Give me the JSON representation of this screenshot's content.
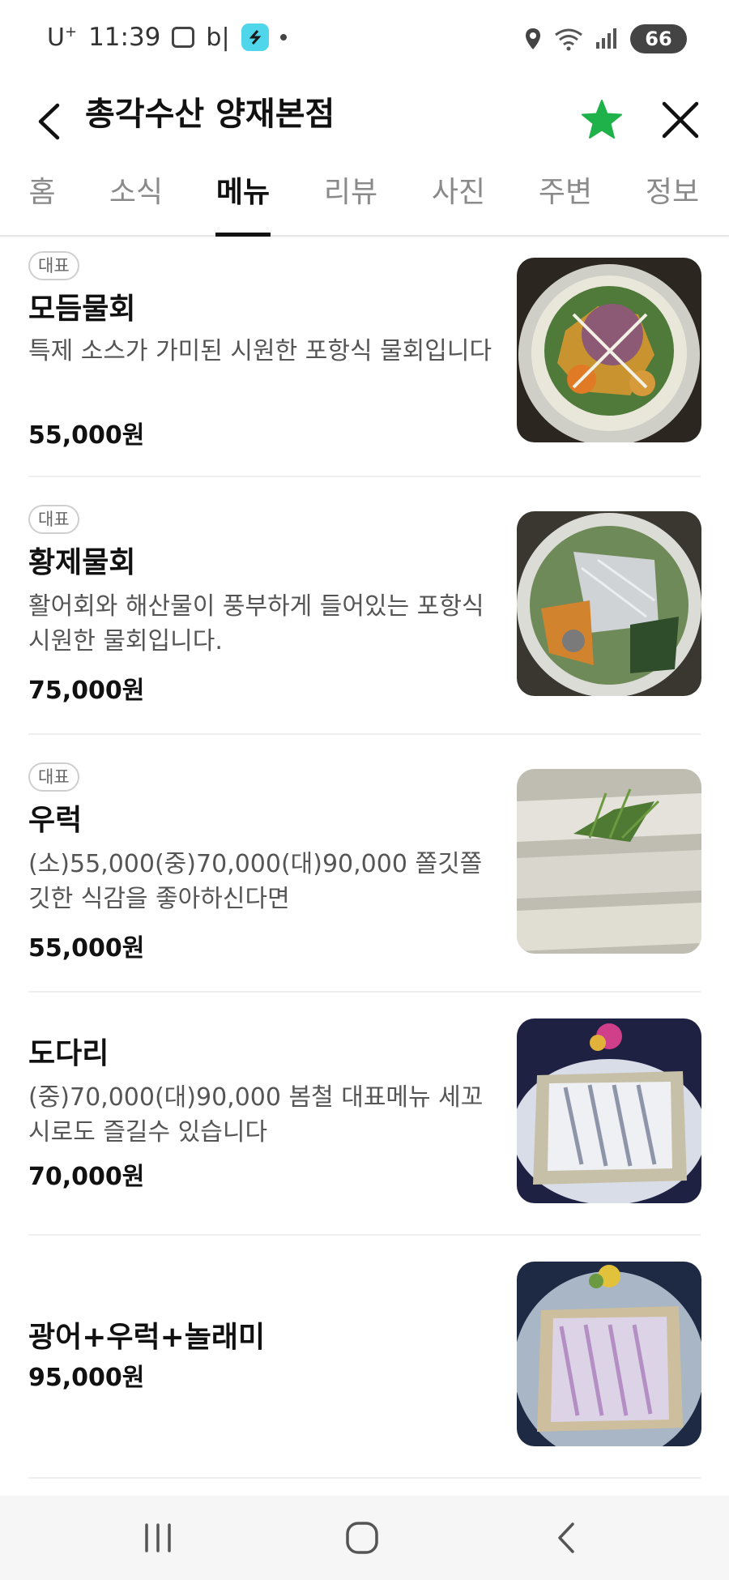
{
  "status_bar": {
    "carrier": "U",
    "carrier_sup": "+",
    "time": "11:39",
    "app_text": "b|",
    "battery": "66"
  },
  "header": {
    "title": "총각수산 양재본점",
    "star_color": "#1fb24a"
  },
  "tabs": [
    {
      "label": "홈"
    },
    {
      "label": "소식"
    },
    {
      "label": "메뉴",
      "active": true
    },
    {
      "label": "리뷰"
    },
    {
      "label": "사진"
    },
    {
      "label": "주변"
    },
    {
      "label": "정보"
    }
  ],
  "menu": [
    {
      "badge": "대표",
      "name": "모듬물회",
      "desc": "특제 소스가 가미된 시원한 포항식 물회입니다",
      "price": "55,000원",
      "photo": "mixed-mulhoe-photo"
    },
    {
      "badge": "대표",
      "name": "황제물회",
      "desc": "활어회와 해산물이 풍부하게 들어있는 포항식 시원한 물회입니다.",
      "price": "75,000원",
      "photo": "emperor-mulhoe-photo"
    },
    {
      "badge": "대표",
      "name": "우럭",
      "desc": "(소)55,000(중)70,000(대)90,000 쫄깃쫄깃한 식감을 좋아하신다면",
      "price": "55,000원",
      "photo": "rockfish-sashimi-photo"
    },
    {
      "badge": "",
      "name": "도다리",
      "desc": "(중)70,000(대)90,000 봄철 대표메뉴 세꼬시로도 즐길수 있습니다",
      "price": "70,000원",
      "photo": "flounder-sashimi-photo"
    },
    {
      "badge": "",
      "name": "광어+우럭+놀래미",
      "desc": "",
      "price": "95,000원",
      "photo": "mixed-sashimi-platter-photo"
    }
  ]
}
